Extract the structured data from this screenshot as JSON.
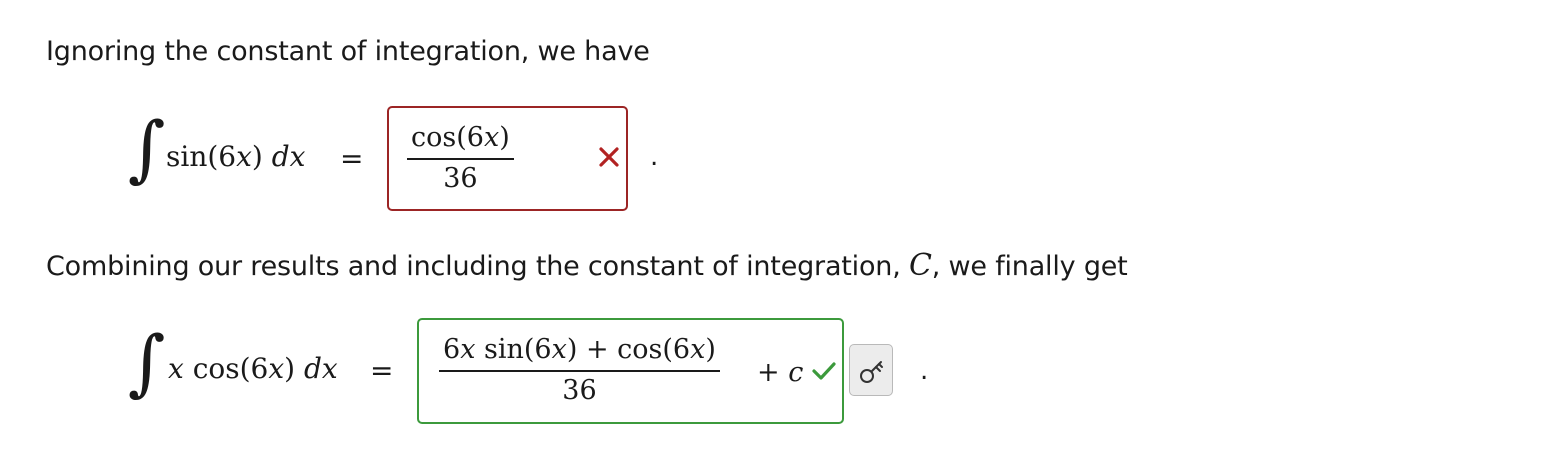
{
  "intro_text": "Ignoring the constant of integration, we have",
  "equation1": {
    "integral_symbol": "∫",
    "lhs_expression": "sin(6x) dx",
    "equals": "=",
    "answer_numerator": "cos(6x)",
    "answer_denominator": "36",
    "status": "incorrect",
    "status_icon": "x-mark-icon",
    "status_color": "#b22222",
    "box_border_color": "#9c2525",
    "trailing": "."
  },
  "combining_text_before": "Combining our results and including the constant of integration, ",
  "combining_variable": "C",
  "combining_text_after": ", we finally get",
  "equation2": {
    "integral_symbol": "∫",
    "lhs_expression": "x cos(6x) dx",
    "equals": "=",
    "answer_numerator": "6x sin(6x) + cos(6x)",
    "answer_denominator": "36",
    "plus_constant": "+ c",
    "status": "correct",
    "status_icon": "check-mark-icon",
    "status_color": "#3c9a3c",
    "box_border_color": "#3c9a3c",
    "key_button_icon": "key-icon",
    "trailing": "."
  }
}
